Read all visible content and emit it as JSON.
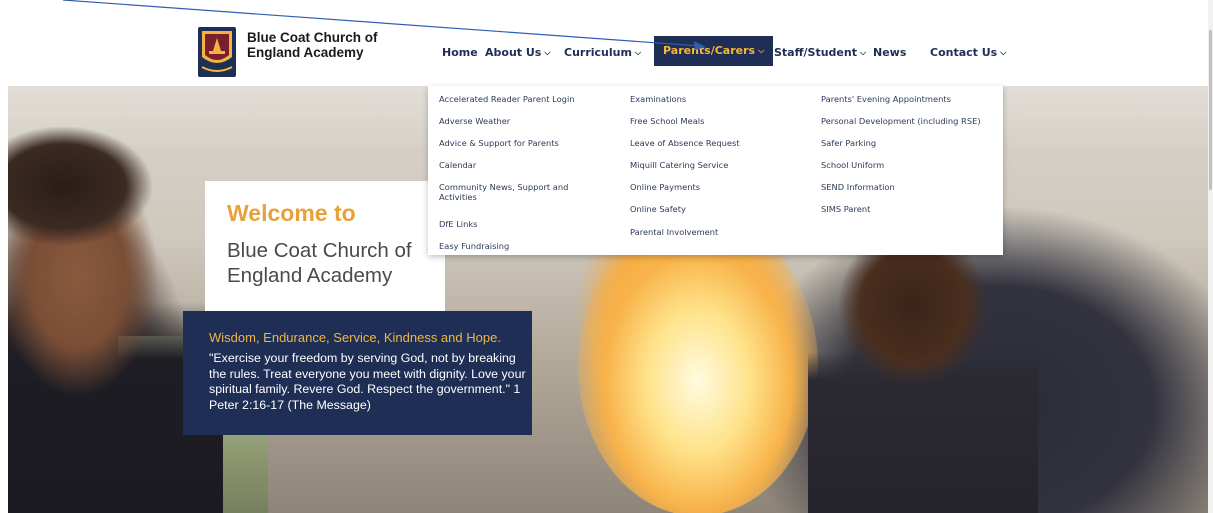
{
  "logo": {
    "line1": "Blue Coat Church of",
    "line2": "England Academy",
    "crest_icon": "school-crest-icon"
  },
  "nav": {
    "home": "Home",
    "about": "About Us",
    "curriculum": "Curriculum",
    "parents": "Parents/Carers",
    "staff": "Staff/Student",
    "news": "News",
    "contact": "Contact Us",
    "chevron": "⌄"
  },
  "dropdown": {
    "col1": [
      "Accelerated Reader Parent Login",
      "Adverse Weather",
      "Advice & Support for Parents",
      "Calendar",
      "Community News, Support and Activities",
      "DfE Links",
      "Easy Fundraising"
    ],
    "col2": [
      "Examinations",
      "Free School Meals",
      "Leave of Absence Request",
      "Miquill Catering Service",
      "Online Payments",
      "Online Safety",
      "Parental Involvement"
    ],
    "col3": [
      "Parents' Evening Appointments",
      "Personal Development (including RSE)",
      "Safer Parking",
      "School Uniform",
      "SEND Information",
      "SIMS Parent"
    ]
  },
  "hero": {
    "welcome": "Welcome to",
    "school_name": "Blue Coat Church of England Academy",
    "motto_heading": "Wisdom, Endurance, Service, Kindness and Hope.",
    "quote": "\"Exercise your freedom by serving God, not by breaking the rules. Treat everyone you meet with dignity. Love your spiritual family. Revere God. Respect the government.\" 1 Peter 2:16-17 (The Message)"
  },
  "colors": {
    "navy": "#1f2e55",
    "gold": "#f1b640",
    "welcome_orange": "#e6a23a",
    "arrow": "#2f5fb3"
  }
}
